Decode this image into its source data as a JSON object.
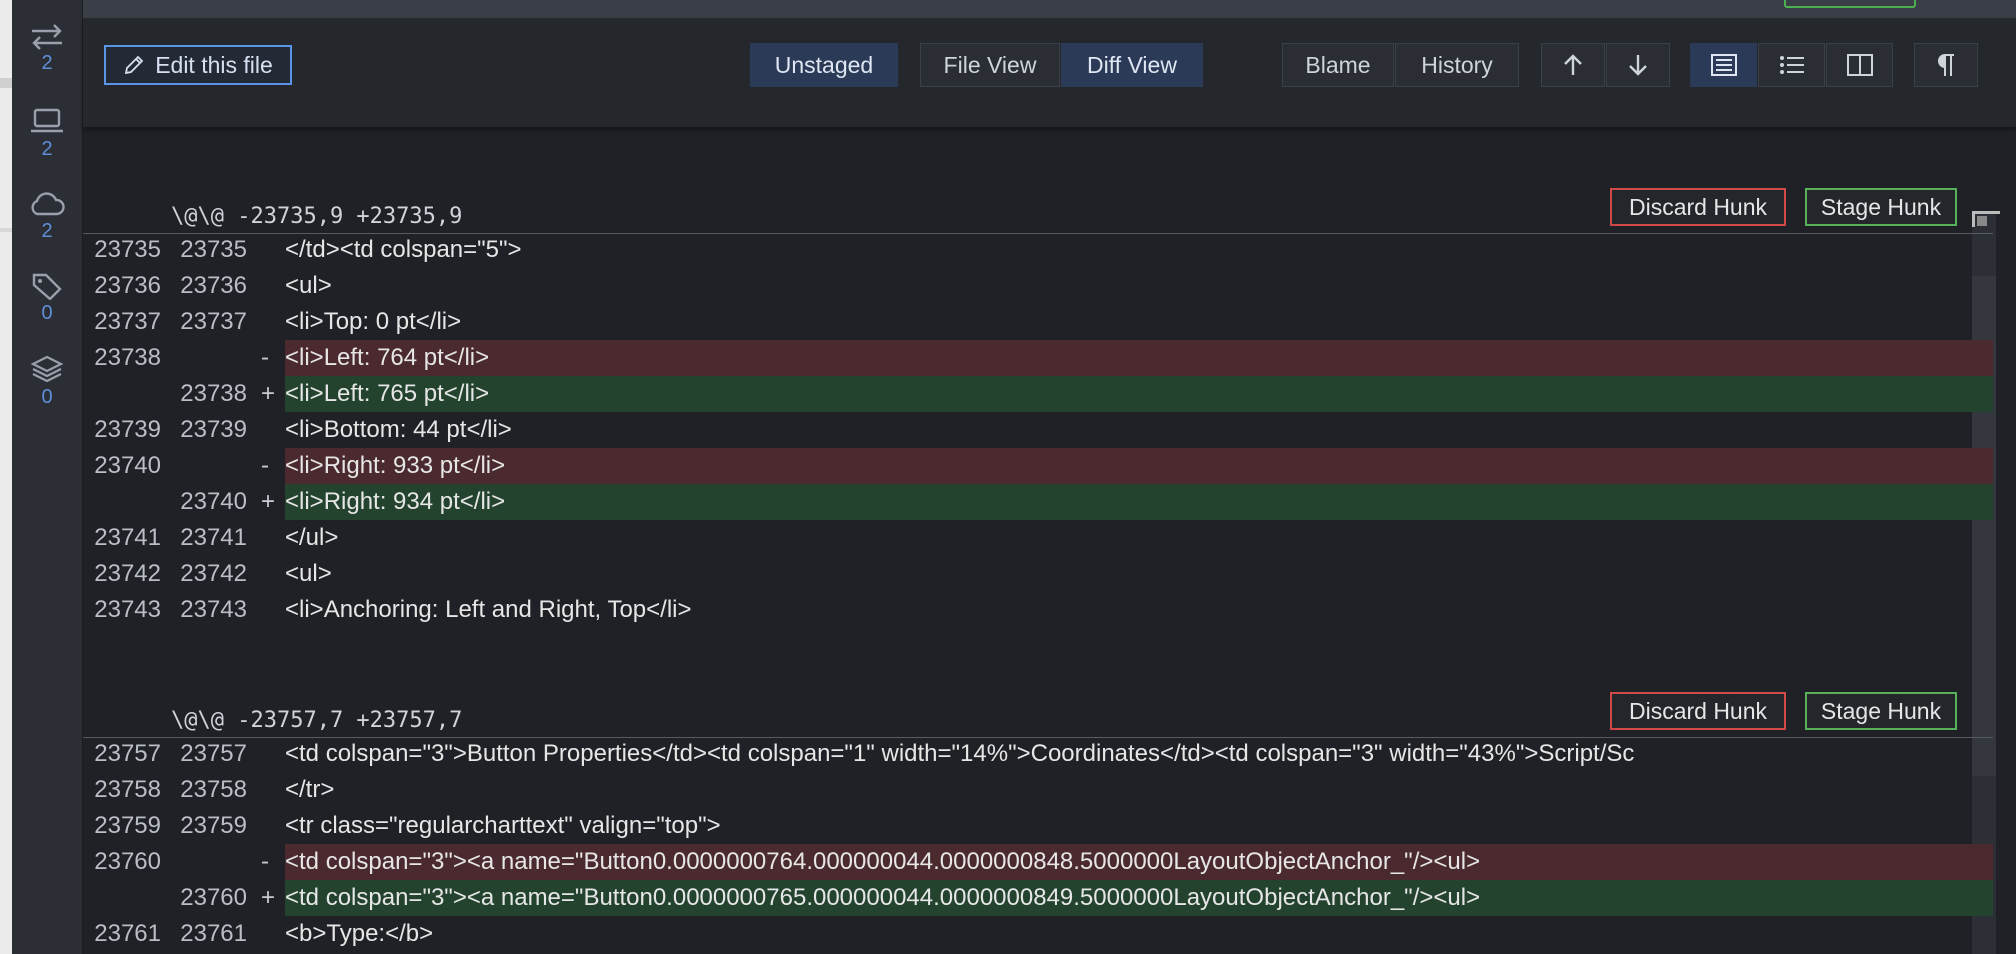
{
  "sidebar": {
    "items": [
      {
        "icon": "transfer-arrows-icon",
        "count": "2"
      },
      {
        "icon": "laptop-icon",
        "count": "2"
      },
      {
        "icon": "cloud-icon",
        "count": "2"
      },
      {
        "icon": "tag-icon",
        "count": "0"
      },
      {
        "icon": "layers-icon",
        "count": "0"
      }
    ]
  },
  "toolbar": {
    "edit_label": "Edit this file",
    "unstaged_label": "Unstaged",
    "file_view_label": "File View",
    "diff_view_label": "Diff View",
    "blame_label": "Blame",
    "history_label": "History",
    "up_icon": "arrow-up-icon",
    "down_icon": "arrow-down-icon",
    "active_view": "Diff View"
  },
  "hunks": [
    {
      "header": "\\@\\@ -23735,9 +23735,9",
      "discard_label": "Discard Hunk",
      "stage_label": "Stage Hunk",
      "lines": [
        {
          "type": "ctx",
          "old": "23735",
          "new": "23735",
          "sign": " ",
          "text": "</td><td colspan=\"5\">"
        },
        {
          "type": "ctx",
          "old": "23736",
          "new": "23736",
          "sign": " ",
          "text": "<ul>"
        },
        {
          "type": "ctx",
          "old": "23737",
          "new": "23737",
          "sign": " ",
          "text": "<li>Top: 0 pt</li>"
        },
        {
          "type": "del",
          "old": "23738",
          "new": "",
          "sign": "-",
          "text": "<li>Left: 764 pt</li>"
        },
        {
          "type": "add",
          "old": "",
          "new": "23738",
          "sign": "+",
          "text": "<li>Left: 765 pt</li>"
        },
        {
          "type": "ctx",
          "old": "23739",
          "new": "23739",
          "sign": " ",
          "text": "<li>Bottom: 44 pt</li>"
        },
        {
          "type": "del",
          "old": "23740",
          "new": "",
          "sign": "-",
          "text": "<li>Right: 933 pt</li>"
        },
        {
          "type": "add",
          "old": "",
          "new": "23740",
          "sign": "+",
          "text": "<li>Right: 934 pt</li>"
        },
        {
          "type": "ctx",
          "old": "23741",
          "new": "23741",
          "sign": " ",
          "text": "</ul>"
        },
        {
          "type": "ctx",
          "old": "23742",
          "new": "23742",
          "sign": " ",
          "text": "<ul>"
        },
        {
          "type": "ctx",
          "old": "23743",
          "new": "23743",
          "sign": " ",
          "text": "<li>Anchoring: Left and Right, Top</li>"
        }
      ]
    },
    {
      "header": "\\@\\@ -23757,7 +23757,7",
      "discard_label": "Discard Hunk",
      "stage_label": "Stage Hunk",
      "lines": [
        {
          "type": "ctx",
          "old": "23757",
          "new": "23757",
          "sign": " ",
          "text": "<td colspan=\"3\">Button Properties</td><td colspan=\"1\" width=\"14%\">Coordinates</td><td colspan=\"3\" width=\"43%\">Script/Sc"
        },
        {
          "type": "ctx",
          "old": "23758",
          "new": "23758",
          "sign": " ",
          "text": "</tr>"
        },
        {
          "type": "ctx",
          "old": "23759",
          "new": "23759",
          "sign": " ",
          "text": "<tr class=\"regularcharttext\" valign=\"top\">"
        },
        {
          "type": "del",
          "old": "23760",
          "new": "",
          "sign": "-",
          "text": "<td colspan=\"3\"><a name=\"Button0.0000000764.000000044.0000000848.5000000LayoutObjectAnchor_\"/><ul>"
        },
        {
          "type": "add",
          "old": "",
          "new": "23760",
          "sign": "+",
          "text": "<td colspan=\"3\"><a name=\"Button0.0000000765.000000044.0000000849.5000000LayoutObjectAnchor_\"/><ul>"
        },
        {
          "type": "ctx",
          "old": "23761",
          "new": "23761",
          "sign": " ",
          "text": "<b>Type:</b>"
        }
      ]
    }
  ],
  "colors": {
    "background": "#1f2126",
    "deleted_line": "#4a2a2f",
    "added_line": "#23432f",
    "discard_border": "#d04a4a",
    "stage_border": "#58b058",
    "accent": "#5b95e8"
  }
}
